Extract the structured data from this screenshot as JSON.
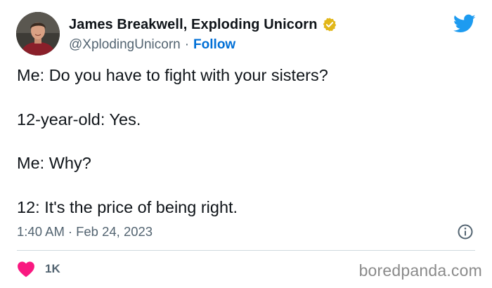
{
  "author": {
    "name": "James Breakwell, Exploding Unicorn",
    "handle": "@XplodingUnicorn",
    "separator": "·",
    "follow_label": "Follow",
    "verified_badge_color": "#e2b719"
  },
  "tweet": {
    "lines": [
      "Me: Do you have to fight with your sisters?",
      "12-year-old: Yes.",
      "Me: Why?",
      "12: It's the price of being right."
    ],
    "time": "1:40 AM",
    "separator": "·",
    "date": "Feb 24, 2023"
  },
  "engagement": {
    "likes": "1K",
    "heart_color": "#f91880"
  },
  "watermark": "boredpanda.com",
  "colors": {
    "twitter_blue": "#1d9bf0",
    "link_blue": "#006fd6",
    "text": "#0f1419",
    "muted": "#536471"
  },
  "icons": [
    "twitter-bird-icon",
    "verified-badge-icon",
    "info-icon",
    "heart-icon"
  ]
}
